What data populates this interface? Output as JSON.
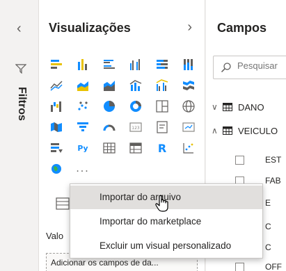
{
  "filters": {
    "label": "Filtros",
    "collapse_icon": "chevron-left-icon"
  },
  "visualizations": {
    "title": "Visualizações",
    "expand_icon": "chevron-right-icon",
    "more": "...",
    "values_label": "Valo",
    "drop_placeholder": "Adicionar os campos de da..."
  },
  "fields": {
    "title": "Campos",
    "search_placeholder": "Pesquisar",
    "tables": [
      {
        "name": "DANO",
        "expanded": false
      },
      {
        "name": "VEICULO",
        "expanded": true
      }
    ],
    "field_items": [
      "EST",
      "FAB",
      "E",
      "C",
      "C",
      "OFF"
    ]
  },
  "context_menu": {
    "items": [
      {
        "label": "Importar do arquivo",
        "hover": true
      },
      {
        "label": "Importar do marketplace",
        "hover": false
      },
      {
        "label": "Excluir um visual personalizado",
        "hover": false
      }
    ]
  },
  "colors": {
    "accent": "#118dff",
    "yellow": "#e8c100",
    "grey": "#605e5c",
    "hover": "#e1dfdd"
  }
}
